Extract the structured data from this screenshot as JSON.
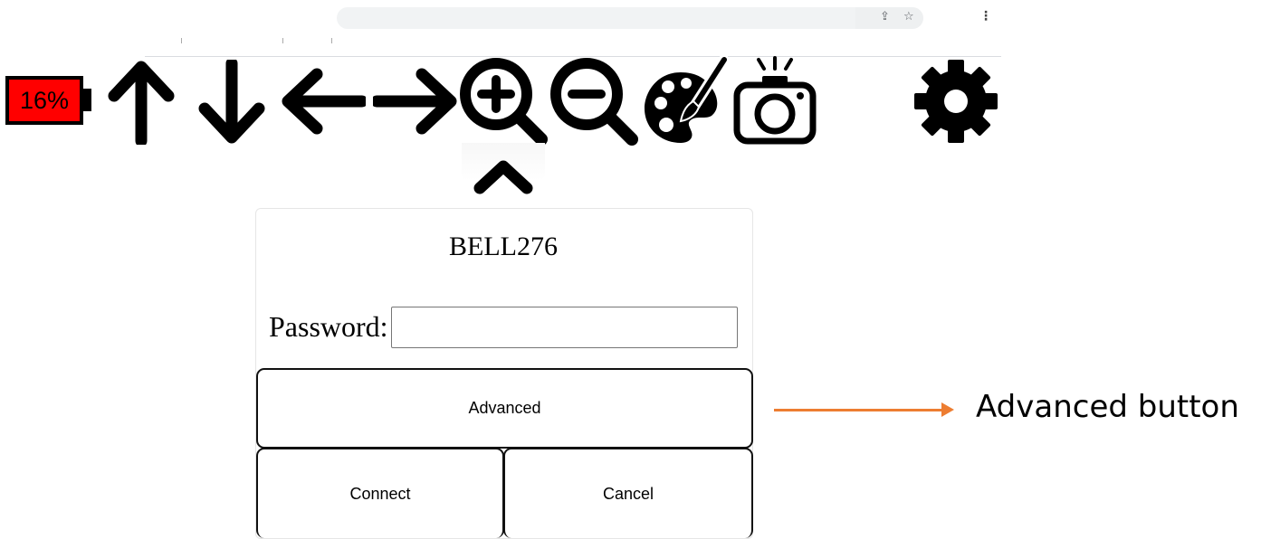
{
  "browser": {
    "share_icon": "share-icon",
    "bookmark_icon": "star-icon",
    "menu_icon": "kebab-menu-icon",
    "share_glyph": "⇪",
    "bookmark_glyph": "☆",
    "menu_glyph": "⋮"
  },
  "toolbar": {
    "battery_level": "16%",
    "battery_fill_fraction": 0.16,
    "battery_color": "#ff0000",
    "icons": [
      "arrow-up-icon",
      "arrow-down-icon",
      "arrow-left-icon",
      "arrow-right-icon",
      "zoom-in-icon",
      "zoom-out-icon",
      "palette-icon",
      "camera-icon",
      "gear-icon"
    ],
    "collapse_icon": "chevron-up-icon"
  },
  "dialog": {
    "network_name": "BELL276",
    "password_label": "Password:",
    "password_value": "",
    "advanced_label": "Advanced",
    "connect_label": "Connect",
    "cancel_label": "Cancel"
  },
  "annotation": {
    "text": "Advanced button",
    "arrow_color": "#ed7d31"
  }
}
